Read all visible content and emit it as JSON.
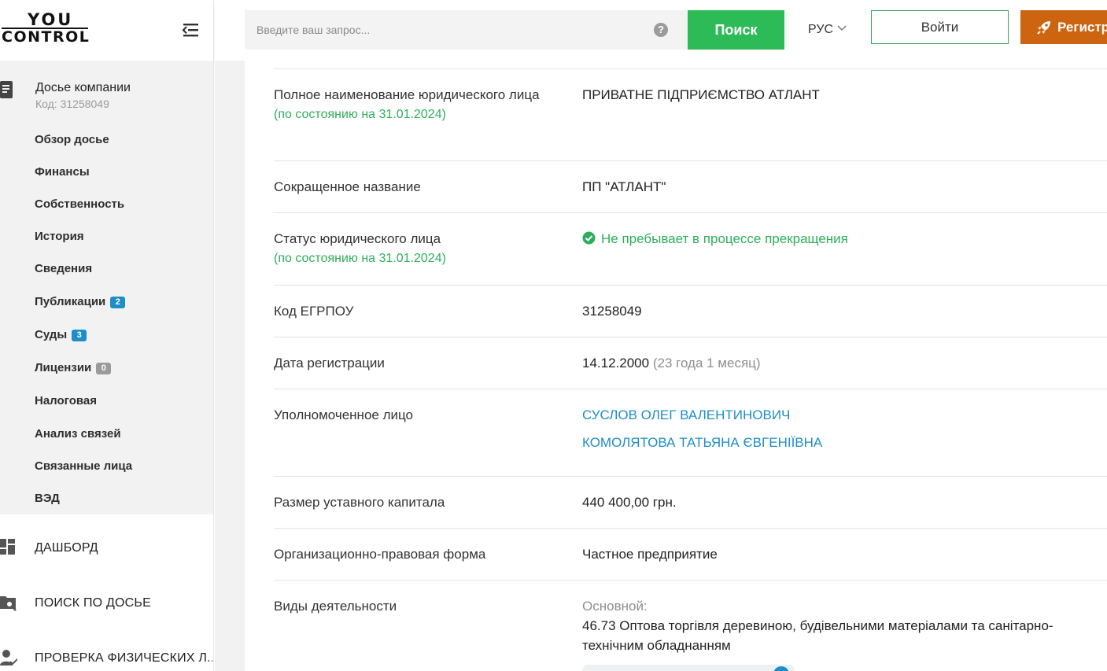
{
  "app": {
    "logo_top": "YOU",
    "logo_bottom": "CONTROL"
  },
  "header": {
    "search_placeholder": "Введите ваш запрос...",
    "help_glyph": "?",
    "search_button": "Поиск",
    "language": "РУС",
    "login_button": "Войти",
    "register_button": "Регистр"
  },
  "sidebar": {
    "dossier_title": "Досье компании",
    "dossier_code": "Код: 31258049",
    "items": [
      {
        "label": "Обзор досье",
        "badge": null
      },
      {
        "label": "Финансы",
        "badge": null
      },
      {
        "label": "Собственность",
        "badge": null
      },
      {
        "label": "История",
        "badge": null
      },
      {
        "label": "Сведения",
        "badge": null
      },
      {
        "label": "Публикации",
        "badge": "2"
      },
      {
        "label": "Суды",
        "badge": "3"
      },
      {
        "label": "Лицензии",
        "badge": "0"
      },
      {
        "label": "Налоговая",
        "badge": null
      },
      {
        "label": "Анализ связей",
        "badge": null
      },
      {
        "label": "Связанные лица",
        "badge": null
      },
      {
        "label": "ВЭД",
        "badge": null
      }
    ],
    "badge_colors": {
      "active": "#1f8dc7",
      "empty": "#9b9b9b"
    },
    "sections": [
      {
        "label": "ДАШБОРД"
      },
      {
        "label": "ПОИСК ПО ДОСЬЕ"
      },
      {
        "label": "ПРОВЕРКА ФИЗИЧЕСКИХ Л..."
      }
    ]
  },
  "details": {
    "full_name": {
      "label": "Полное наименование юридического лица",
      "note": "(по состоянию на 31.01.2024)",
      "value": "ПРИВАТНЕ ПІДПРИЄМСТВО АТЛАНТ"
    },
    "short_name": {
      "label": "Сокращенное название",
      "value": "ПП \"АТЛАНТ\""
    },
    "status": {
      "label": "Статус юридического лица",
      "note": "(по состоянию на 31.01.2024)",
      "value": "Не пребывает в процессе прекращения"
    },
    "edrpou": {
      "label": "Код ЕГРПОУ",
      "value": "31258049"
    },
    "reg_date": {
      "label": "Дата регистрации",
      "value": "14.12.2000",
      "age": "(23 года 1 месяц)"
    },
    "authorized": {
      "label": "Уполномоченное лицо",
      "persons": [
        "СУСЛОВ ОЛЕГ ВАЛЕНТИНОВИЧ",
        "КОМОЛЯТОВА ТАТЬЯНА ЄВГЕНІЇВНА"
      ]
    },
    "capital": {
      "label": "Размер уставного капитала",
      "value": "440 400,00 грн."
    },
    "legal_form": {
      "label": "Организационно-правовая форма",
      "value": "Частное предприятие"
    },
    "activities": {
      "label": "Виды деятельности",
      "main_label": "Основной:",
      "main_value": "46.73 Оптова торгівля деревиною, будівельними матеріалами та санітарно-технічним обладнанням"
    }
  },
  "colors": {
    "green": "#2dbb57",
    "orange": "#cc6410",
    "link": "#1f8dc7"
  }
}
